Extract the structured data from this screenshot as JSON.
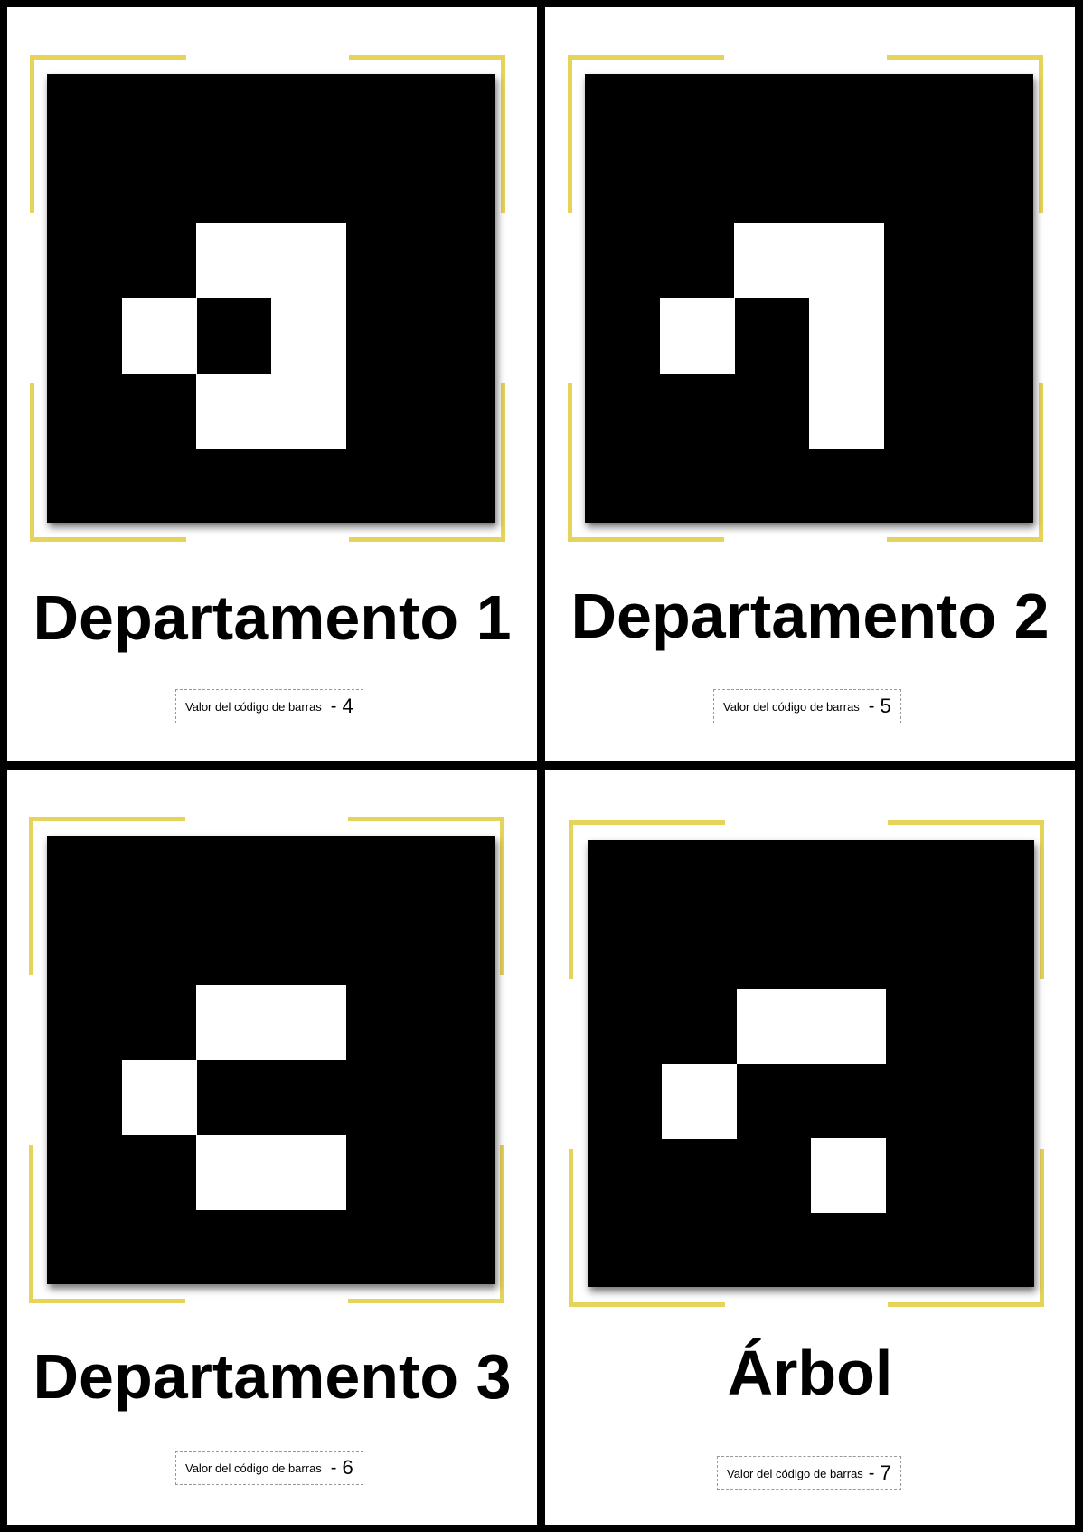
{
  "cards": [
    {
      "title": "Departamento 1",
      "barcode_label": "Valor del código de barras",
      "barcode_dash": "-",
      "barcode_value": "4",
      "pattern": [
        [
          0,
          0,
          0,
          0
        ],
        [
          0,
          1,
          1,
          0
        ],
        [
          1,
          0,
          1,
          0
        ],
        [
          0,
          1,
          1,
          0
        ]
      ]
    },
    {
      "title": "Departamento 2",
      "barcode_label": "Valor del código de barras",
      "barcode_dash": "-",
      "barcode_value": "5",
      "pattern": [
        [
          0,
          0,
          0,
          0
        ],
        [
          0,
          1,
          1,
          0
        ],
        [
          1,
          0,
          1,
          0
        ],
        [
          0,
          0,
          1,
          0
        ]
      ]
    },
    {
      "title": "Departamento 3",
      "barcode_label": "Valor del código de barras",
      "barcode_dash": "-",
      "barcode_value": "6",
      "pattern": [
        [
          0,
          0,
          0,
          0
        ],
        [
          0,
          1,
          1,
          0
        ],
        [
          1,
          0,
          0,
          0
        ],
        [
          0,
          1,
          1,
          0
        ]
      ]
    },
    {
      "title": "Árbol",
      "barcode_label": "Valor del código de barras",
      "barcode_dash": "-",
      "barcode_value": "7",
      "pattern": [
        [
          0,
          0,
          0,
          0
        ],
        [
          0,
          1,
          1,
          0
        ],
        [
          1,
          0,
          0,
          0
        ],
        [
          0,
          0,
          1,
          0
        ]
      ]
    }
  ],
  "colors": {
    "frame": "#000000",
    "card": "#ffffff",
    "bracket": "#e6d35a",
    "marker": "#000000",
    "marker_cell": "#ffffff"
  }
}
